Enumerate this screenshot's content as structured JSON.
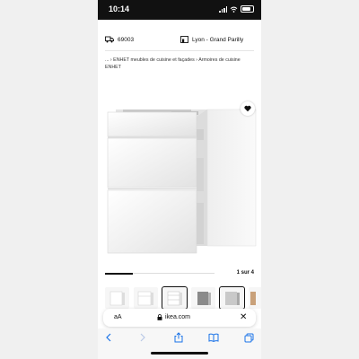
{
  "status_bar": {
    "time": "10:14"
  },
  "store_info": {
    "postal_code": "69003",
    "store_name": "Lyon - Grand Parilly"
  },
  "breadcrumb": {
    "ellipsis": "...",
    "items": [
      "ENHET meubles de cuisine et façades",
      "Armoires de cuisine",
      "ENHET"
    ]
  },
  "carousel": {
    "position": "1 sur 4",
    "progress_fraction": 0.25
  },
  "thumbnails_count_visible": 6,
  "address_bar": {
    "text_size_label": "aA",
    "url": "ikea.com"
  },
  "colors": {
    "accent": "#0058a3",
    "statusbar": "#111111",
    "text": "#111111"
  },
  "icons": [
    "delivery-truck-icon",
    "store-icon",
    "heart-icon",
    "lock-icon",
    "close-icon",
    "back-icon",
    "forward-icon",
    "share-icon",
    "bookmarks-icon",
    "tabs-icon"
  ]
}
